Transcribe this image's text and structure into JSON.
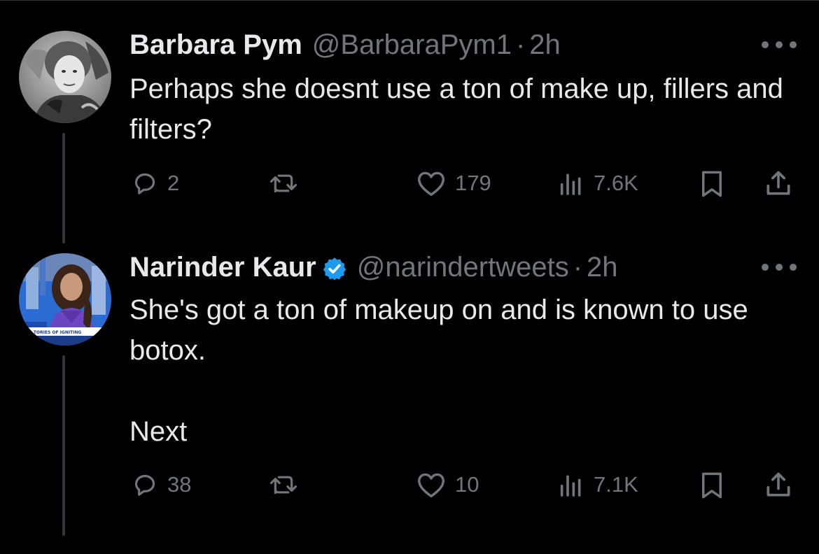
{
  "tweets": [
    {
      "display_name": "Barbara Pym",
      "handle": "@BarbaraPym1",
      "separator": "·",
      "time": "2h",
      "verified": false,
      "text": "Perhaps she doesnt use a ton of make up, fillers and filters?",
      "replies": "2",
      "retweets": "",
      "likes": "179",
      "views": "7.6K"
    },
    {
      "display_name": "Narinder Kaur",
      "handle": "@narindertweets",
      "separator": "·",
      "time": "2h",
      "verified": true,
      "text": "She's got a ton of makeup on and is known to use botox.\n\nNext",
      "replies": "38",
      "retweets": "",
      "likes": "10",
      "views": "7.1K"
    }
  ],
  "colors": {
    "background": "#000000",
    "text": "#e7e9ea",
    "muted": "#71767b",
    "verified": "#1d9bf0",
    "thread_line": "#333639"
  },
  "icons": [
    "reply-icon",
    "retweet-icon",
    "like-icon",
    "views-icon",
    "bookmark-icon",
    "share-icon",
    "more-icon",
    "verified-badge-icon"
  ]
}
